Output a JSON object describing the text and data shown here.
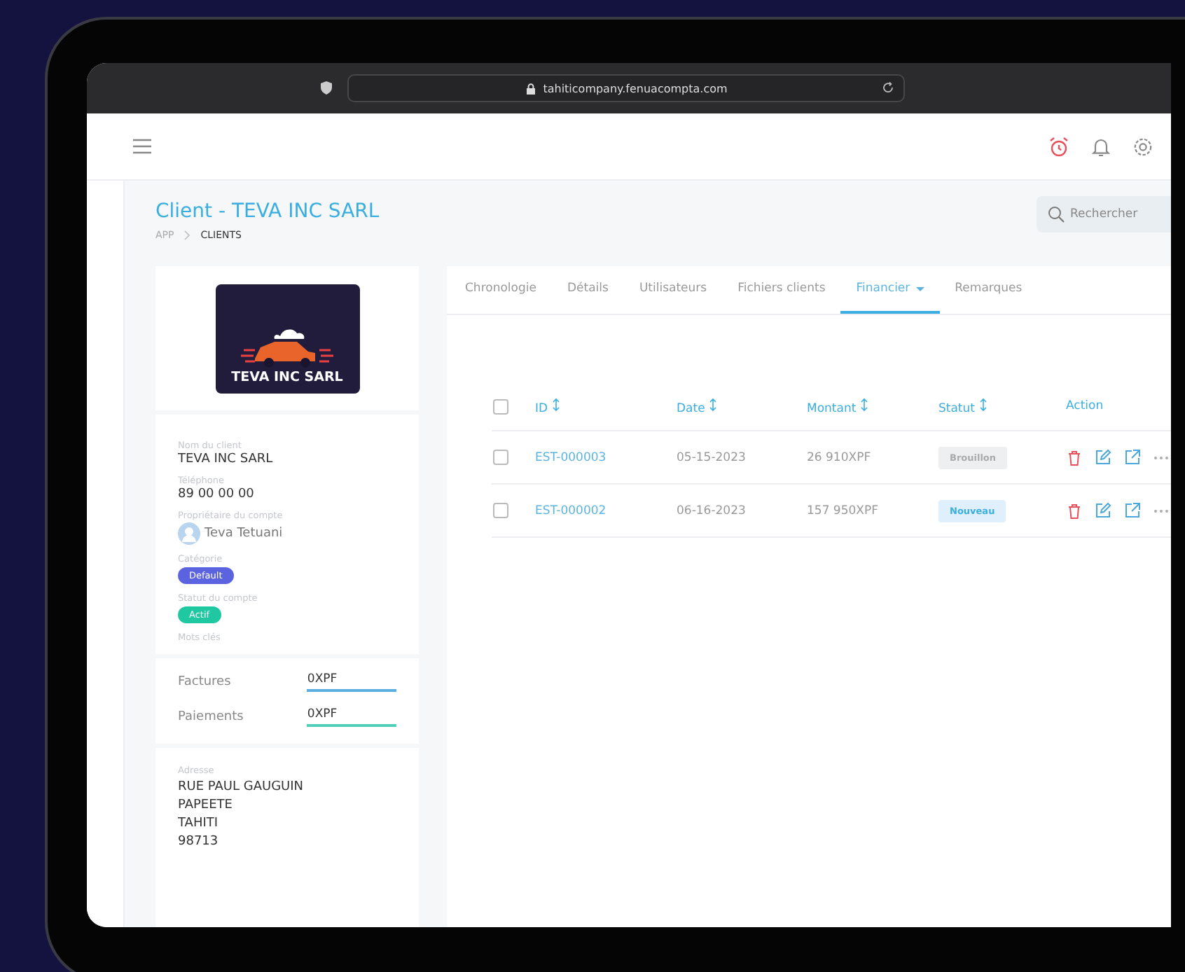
{
  "browser": {
    "url": "tahiticompany.fenuacompta.com"
  },
  "page": {
    "title": "Client - TEVA INC SARL",
    "breadcrumb": [
      "APP",
      "CLIENTS"
    ],
    "search": {
      "placeholder": "Rechercher"
    }
  },
  "client_card": {
    "logo_text": "TEVA INC SARL",
    "fields": [
      {
        "kind": "text",
        "label": "Nom du client",
        "value": "TEVA INC SARL"
      },
      {
        "kind": "text",
        "label": "Téléphone",
        "value": "89 00 00 00"
      },
      {
        "kind": "user",
        "label": "Propriétaire du compte",
        "value": "Teva Tetuani"
      },
      {
        "kind": "tag",
        "label": "Catégorie",
        "value": "Default",
        "color": "#5b63e0"
      },
      {
        "kind": "tag",
        "label": "Statut du compte",
        "value": "Actif",
        "color": "#1fc8a0"
      },
      {
        "kind": "empty",
        "label": "Mots clés"
      }
    ],
    "totals": [
      {
        "label": "Factures",
        "value": "0XPF",
        "color": "#5aaee0"
      },
      {
        "label": "Paiements",
        "value": "0XPF",
        "color": "#4fcfb8"
      }
    ],
    "address": {
      "label": "Adresse",
      "lines": [
        "RUE PAUL GAUGUIN",
        "PAPEETE",
        "TAHITI",
        "98713"
      ]
    }
  },
  "tabs": [
    {
      "label": "Chronologie",
      "selected": false,
      "dropdown": false
    },
    {
      "label": "Détails",
      "selected": false,
      "dropdown": false
    },
    {
      "label": "Utilisateurs",
      "selected": false,
      "dropdown": false
    },
    {
      "label": "Fichiers clients",
      "selected": false,
      "dropdown": false
    },
    {
      "label": "Financier",
      "selected": true,
      "dropdown": true
    },
    {
      "label": "Remarques",
      "selected": false,
      "dropdown": false
    }
  ],
  "table": {
    "checked": false,
    "columns": [
      {
        "label": "ID",
        "sortable": true
      },
      {
        "label": "Date",
        "sortable": true
      },
      {
        "label": "Montant",
        "sortable": true
      },
      {
        "label": "Statut",
        "sortable": true
      },
      {
        "label": "Action",
        "sortable": false
      }
    ],
    "rows": [
      {
        "checked": false,
        "id": "EST-000003",
        "date": "05-15-2023",
        "amount": "26 910XPF",
        "status": "Brouillon",
        "kind": "draft"
      },
      {
        "checked": false,
        "id": "EST-000002",
        "date": "06-16-2023",
        "amount": "157 950XPF",
        "status": "Nouveau",
        "kind": "new"
      }
    ]
  }
}
